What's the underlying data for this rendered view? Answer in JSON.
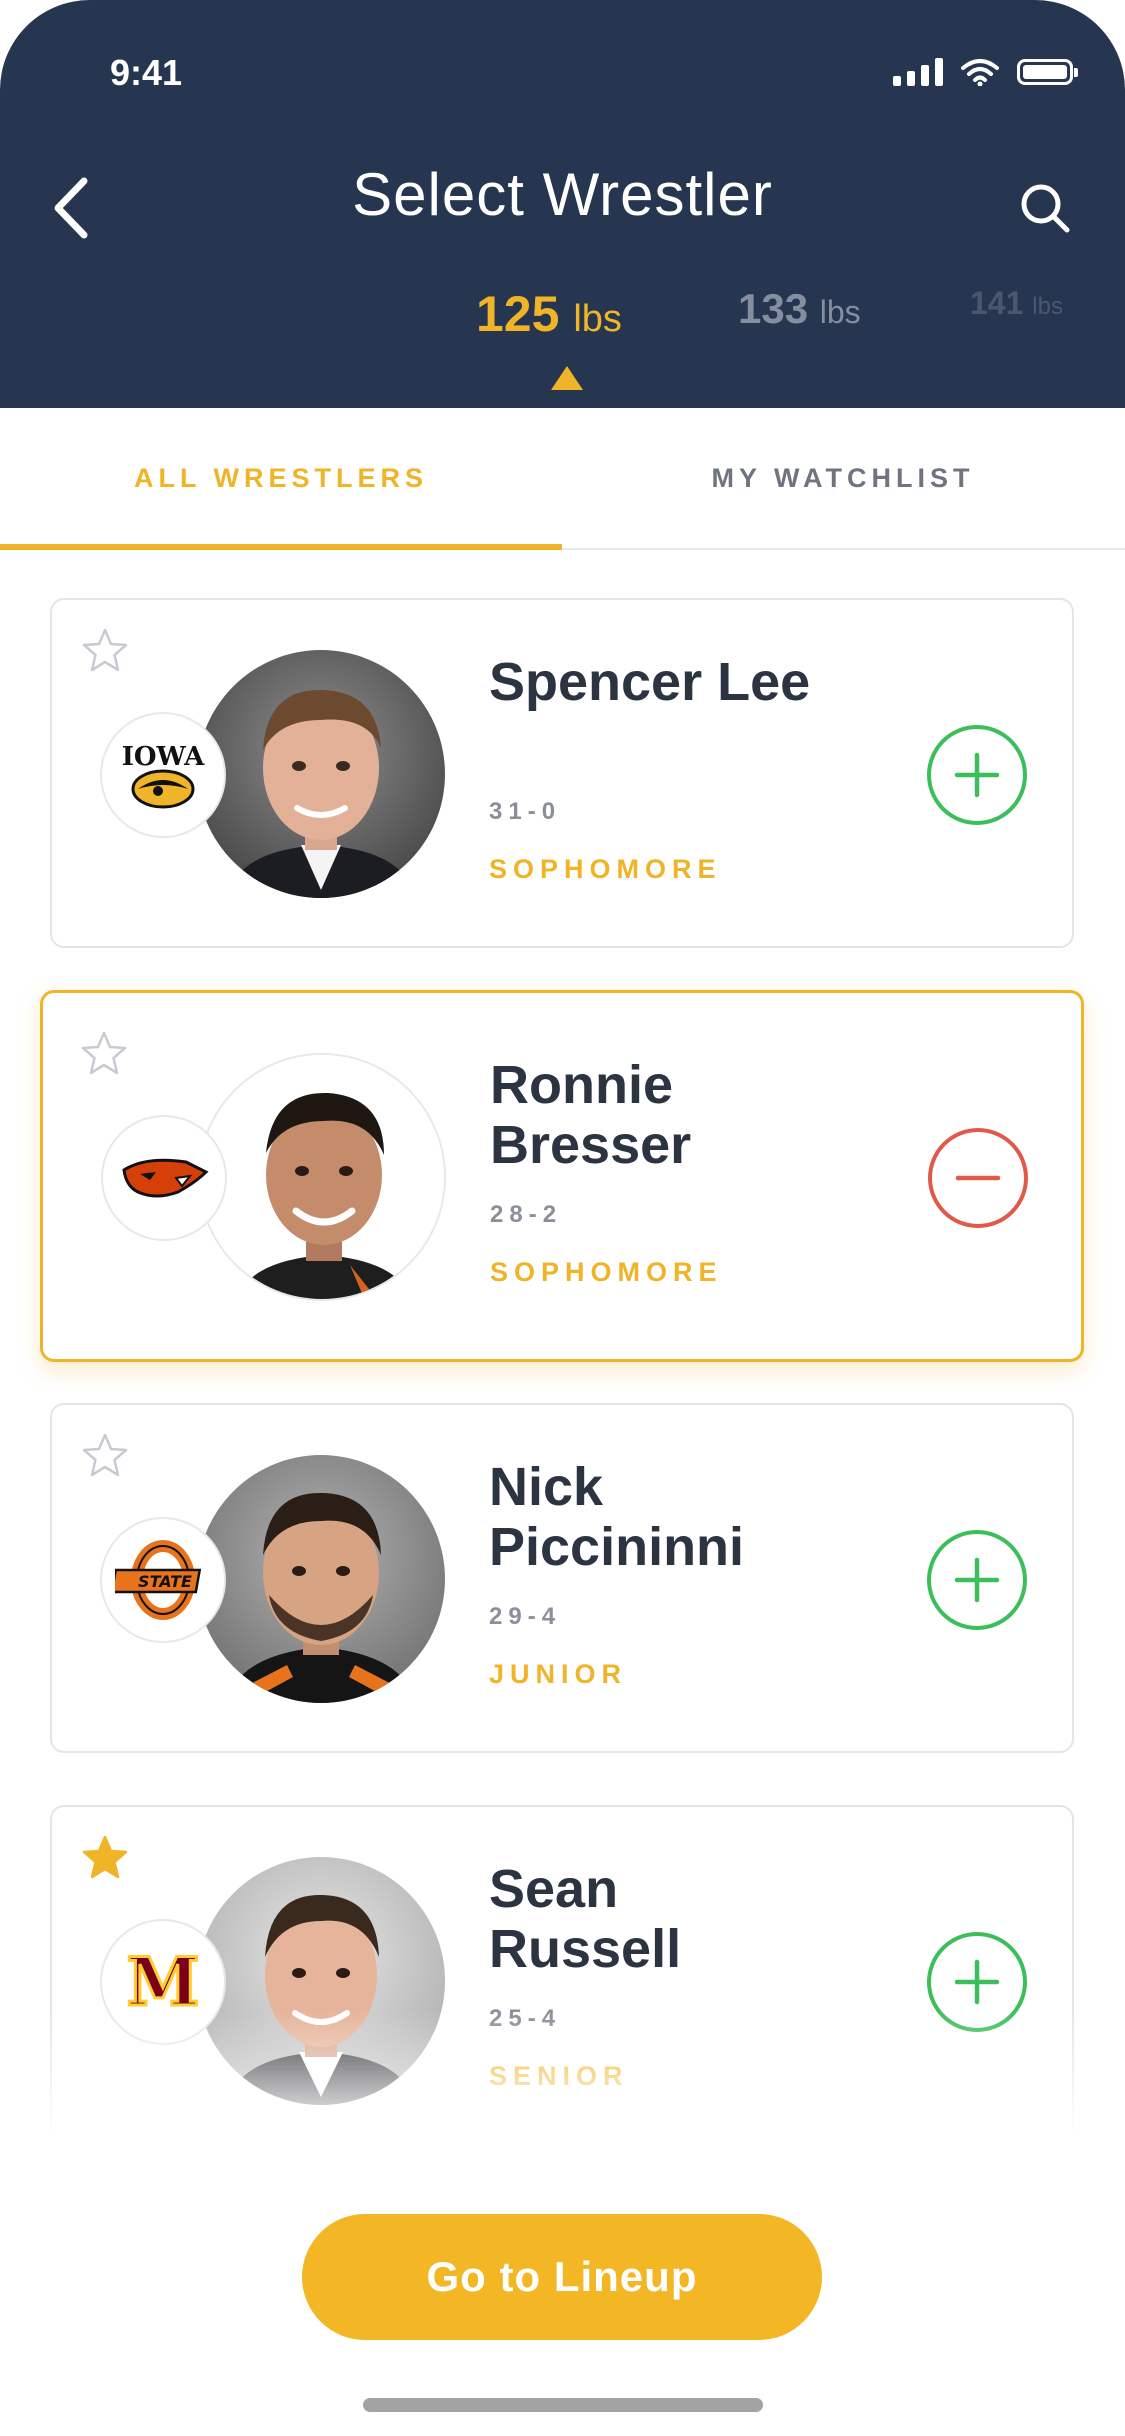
{
  "status": {
    "time": "9:41"
  },
  "header": {
    "title": "Select Wrestler"
  },
  "weights": [
    {
      "num": "125",
      "unit": "lbs",
      "active": true
    },
    {
      "num": "133",
      "unit": "lbs"
    },
    {
      "num": "141",
      "unit": "lbs"
    }
  ],
  "tabs": {
    "all": "ALL WRESTLERS",
    "watchlist": "MY WATCHLIST"
  },
  "wrestlers": [
    {
      "name": "Spencer Lee",
      "record": "31-0",
      "class": "SOPHOMORE",
      "school_logo": "IOWA",
      "starred": false,
      "action": "add"
    },
    {
      "name": "Ronnie Bresser",
      "record": "28-2",
      "class": "SOPHOMORE",
      "school_logo": "beaver-logo",
      "starred": false,
      "action": "remove",
      "selected": true
    },
    {
      "name": "Nick Piccininni",
      "record": "29-4",
      "class": "JUNIOR",
      "school_logo": "STATE",
      "starred": false,
      "action": "add"
    },
    {
      "name": "Sean Russell",
      "record": "25-4",
      "class": "SENIOR",
      "school_logo": "M",
      "starred": true,
      "action": "add"
    }
  ],
  "footer": {
    "cta": "Go to Lineup"
  },
  "colors": {
    "header": "#263550",
    "accent": "#F0B429",
    "add": "#3CBF5A",
    "remove": "#E05A4B"
  }
}
